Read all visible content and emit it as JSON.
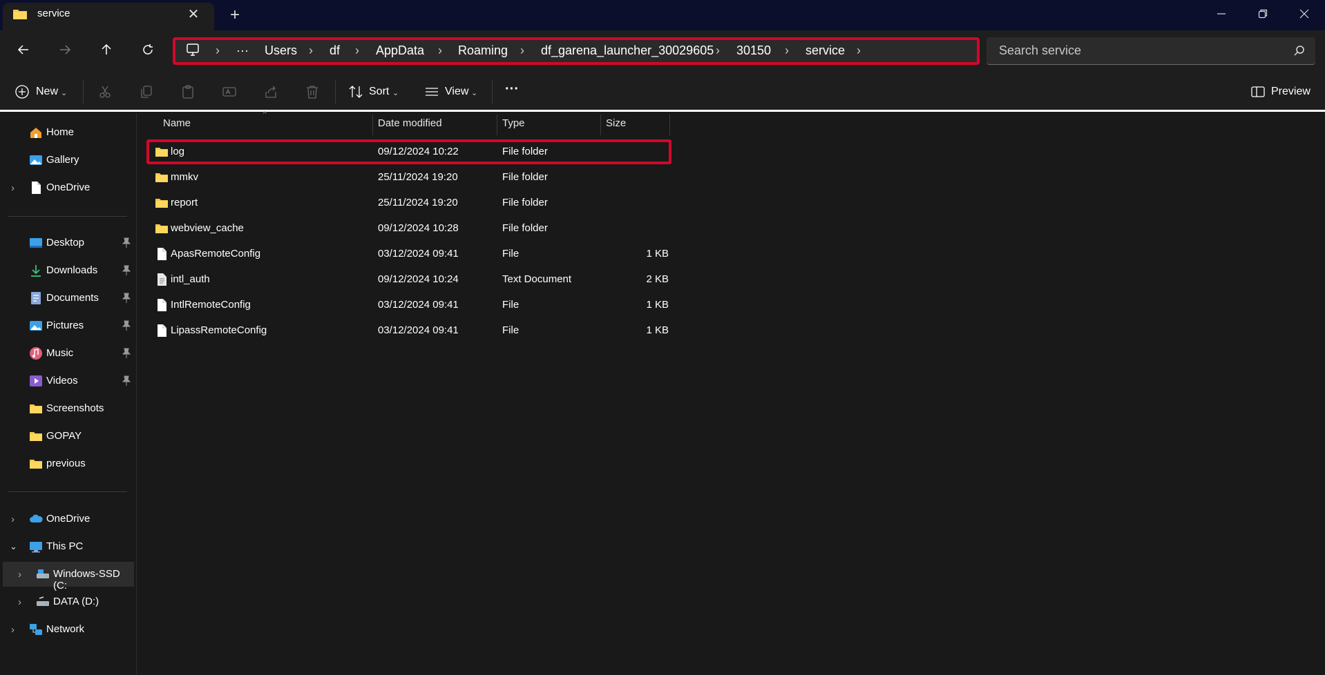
{
  "window": {
    "tab_title": "service",
    "tab_close_glyph": "✕",
    "new_tab_glyph": "+"
  },
  "address": {
    "breadcrumbs": [
      "Users",
      "df",
      "AppData",
      "Roaming",
      "df_garena_launcher_30029605",
      "30150",
      "service"
    ],
    "overflow": "···",
    "search_placeholder": "Search service"
  },
  "commands": {
    "new": "New",
    "sort": "Sort",
    "view": "View",
    "more": "···",
    "preview": "Preview"
  },
  "sidebar": {
    "quick": [
      {
        "label": "Home",
        "icon": "home-icon"
      },
      {
        "label": "Gallery",
        "icon": "gallery-icon"
      },
      {
        "label": "OneDrive",
        "icon": "document-icon"
      }
    ],
    "pinned": [
      {
        "label": "Desktop",
        "icon": "desktop-icon"
      },
      {
        "label": "Downloads",
        "icon": "downloads-icon"
      },
      {
        "label": "Documents",
        "icon": "documents-icon"
      },
      {
        "label": "Pictures",
        "icon": "pictures-icon"
      },
      {
        "label": "Music",
        "icon": "music-icon"
      },
      {
        "label": "Videos",
        "icon": "videos-icon"
      },
      {
        "label": "Screenshots",
        "icon": "folder-icon"
      },
      {
        "label": "GOPAY",
        "icon": "folder-icon"
      },
      {
        "label": "previous",
        "icon": "folder-icon"
      }
    ],
    "tree": [
      {
        "label": "OneDrive",
        "icon": "cloud-icon"
      },
      {
        "label": "This PC",
        "icon": "pc-icon"
      },
      {
        "label": "Windows-SSD (C:",
        "icon": "drive-icon"
      },
      {
        "label": "DATA (D:)",
        "icon": "drive-icon"
      },
      {
        "label": "Network",
        "icon": "network-icon"
      }
    ]
  },
  "table": {
    "columns": [
      "Name",
      "Date modified",
      "Type",
      "Size"
    ],
    "rows": [
      {
        "name": "log",
        "date": "09/12/2024 10:22",
        "type": "File folder",
        "size": "",
        "kind": "folder"
      },
      {
        "name": "mmkv",
        "date": "25/11/2024 19:20",
        "type": "File folder",
        "size": "",
        "kind": "folder"
      },
      {
        "name": "report",
        "date": "25/11/2024 19:20",
        "type": "File folder",
        "size": "",
        "kind": "folder"
      },
      {
        "name": "webview_cache",
        "date": "09/12/2024 10:28",
        "type": "File folder",
        "size": "",
        "kind": "folder"
      },
      {
        "name": "ApasRemoteConfig",
        "date": "03/12/2024 09:41",
        "type": "File",
        "size": "1 KB",
        "kind": "file"
      },
      {
        "name": "intl_auth",
        "date": "09/12/2024 10:24",
        "type": "Text Document",
        "size": "2 KB",
        "kind": "text"
      },
      {
        "name": "IntlRemoteConfig",
        "date": "03/12/2024 09:41",
        "type": "File",
        "size": "1 KB",
        "kind": "file"
      },
      {
        "name": "LipassRemoteConfig",
        "date": "03/12/2024 09:41",
        "type": "File",
        "size": "1 KB",
        "kind": "file"
      }
    ]
  },
  "colors": {
    "highlight": "#d3072a",
    "folder": "#f7c948",
    "accent": "#3ba1e8"
  }
}
